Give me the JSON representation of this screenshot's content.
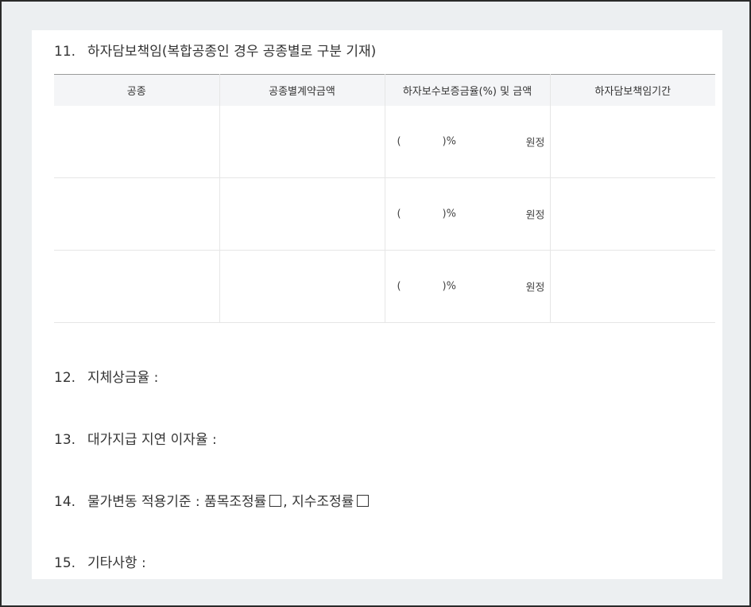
{
  "section11": {
    "number": "11.",
    "title": "하자담보책임(복합공종인 경우 공종별로 구분 기재)",
    "table": {
      "headers": [
        "공종",
        "공종별계약금액",
        "하자보수보증금율(%) 및 금액",
        "하자담보책임기간"
      ],
      "rows": [
        {
          "trade": "",
          "amount": "",
          "paren_open": "(",
          "percent": ")%",
          "won": "원정",
          "period": ""
        },
        {
          "trade": "",
          "amount": "",
          "paren_open": "(",
          "percent": ")%",
          "won": "원정",
          "period": ""
        },
        {
          "trade": "",
          "amount": "",
          "paren_open": "(",
          "percent": ")%",
          "won": "원정",
          "period": ""
        }
      ]
    }
  },
  "section12": {
    "number": "12.",
    "label": "지체상금율 :"
  },
  "section13": {
    "number": "13.",
    "label": "대가지급 지연 이자율 :"
  },
  "section14": {
    "number": "14.",
    "label": "물가변동 적용기준 : 품목조정률",
    "separator": ",",
    "label2": "지수조정률",
    "checkbox_icon": "empty-square"
  },
  "section15": {
    "number": "15.",
    "label": "기타사항 :"
  }
}
